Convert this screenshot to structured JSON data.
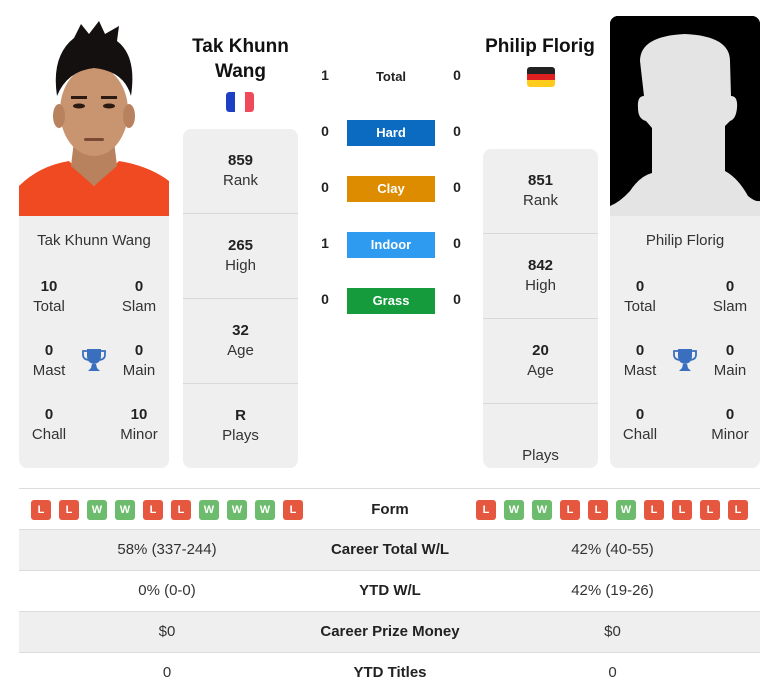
{
  "colors": {
    "win": "#6dbb6d",
    "loss": "#e5573f",
    "hard": "#0a6bc0",
    "clay": "#dd8c00",
    "indoor": "#2e9af0",
    "grass": "#159a3c",
    "trophy": "#3a6fc0",
    "card_bg": "#efefef"
  },
  "player1": {
    "name": "Tak Khunn Wang",
    "name_line1": "Tak Khunn",
    "name_line2": "Wang",
    "flag": "France",
    "photo": "player-photo",
    "titles": {
      "total": "10",
      "total_label": "Total",
      "slam": "0",
      "slam_label": "Slam",
      "mast": "0",
      "mast_label": "Mast",
      "main": "0",
      "main_label": "Main",
      "chall": "0",
      "chall_label": "Chall",
      "minor": "10",
      "minor_label": "Minor"
    },
    "stats": {
      "rank": "859",
      "rank_label": "Rank",
      "high": "265",
      "high_label": "High",
      "age": "32",
      "age_label": "Age",
      "plays": "R",
      "plays_label": "Plays"
    },
    "form": [
      "L",
      "L",
      "W",
      "W",
      "L",
      "L",
      "W",
      "W",
      "W",
      "L"
    ]
  },
  "player2": {
    "name": "Philip Florig",
    "flag": "Germany",
    "photo": "silhouette-placeholder",
    "titles": {
      "total": "0",
      "total_label": "Total",
      "slam": "0",
      "slam_label": "Slam",
      "mast": "0",
      "mast_label": "Mast",
      "main": "0",
      "main_label": "Main",
      "chall": "0",
      "chall_label": "Chall",
      "minor": "0",
      "minor_label": "Minor"
    },
    "stats": {
      "rank": "851",
      "rank_label": "Rank",
      "high": "842",
      "high_label": "High",
      "age": "20",
      "age_label": "Age",
      "plays": "",
      "plays_label": "Plays"
    },
    "form": [
      "L",
      "W",
      "W",
      "L",
      "L",
      "W",
      "L",
      "L",
      "L",
      "L"
    ]
  },
  "h2h": {
    "total": {
      "label": "Total",
      "p1": "1",
      "p2": "0"
    },
    "surfaces": [
      {
        "label": "Hard",
        "p1": "0",
        "p2": "0",
        "color": "#0a6bc0"
      },
      {
        "label": "Clay",
        "p1": "0",
        "p2": "0",
        "color": "#dd8c00"
      },
      {
        "label": "Indoor",
        "p1": "1",
        "p2": "0",
        "color": "#2e9af0"
      },
      {
        "label": "Grass",
        "p1": "0",
        "p2": "0",
        "color": "#159a3c"
      }
    ]
  },
  "comparison": {
    "form_label": "Form",
    "rows": [
      {
        "label": "Career Total W/L",
        "p1": "58% (337-244)",
        "p2": "42% (40-55)"
      },
      {
        "label": "YTD W/L",
        "p1": "0% (0-0)",
        "p2": "42% (19-26)"
      },
      {
        "label": "Career Prize Money",
        "p1": "$0",
        "p2": "$0"
      },
      {
        "label": "YTD Titles",
        "p1": "0",
        "p2": "0"
      }
    ]
  }
}
